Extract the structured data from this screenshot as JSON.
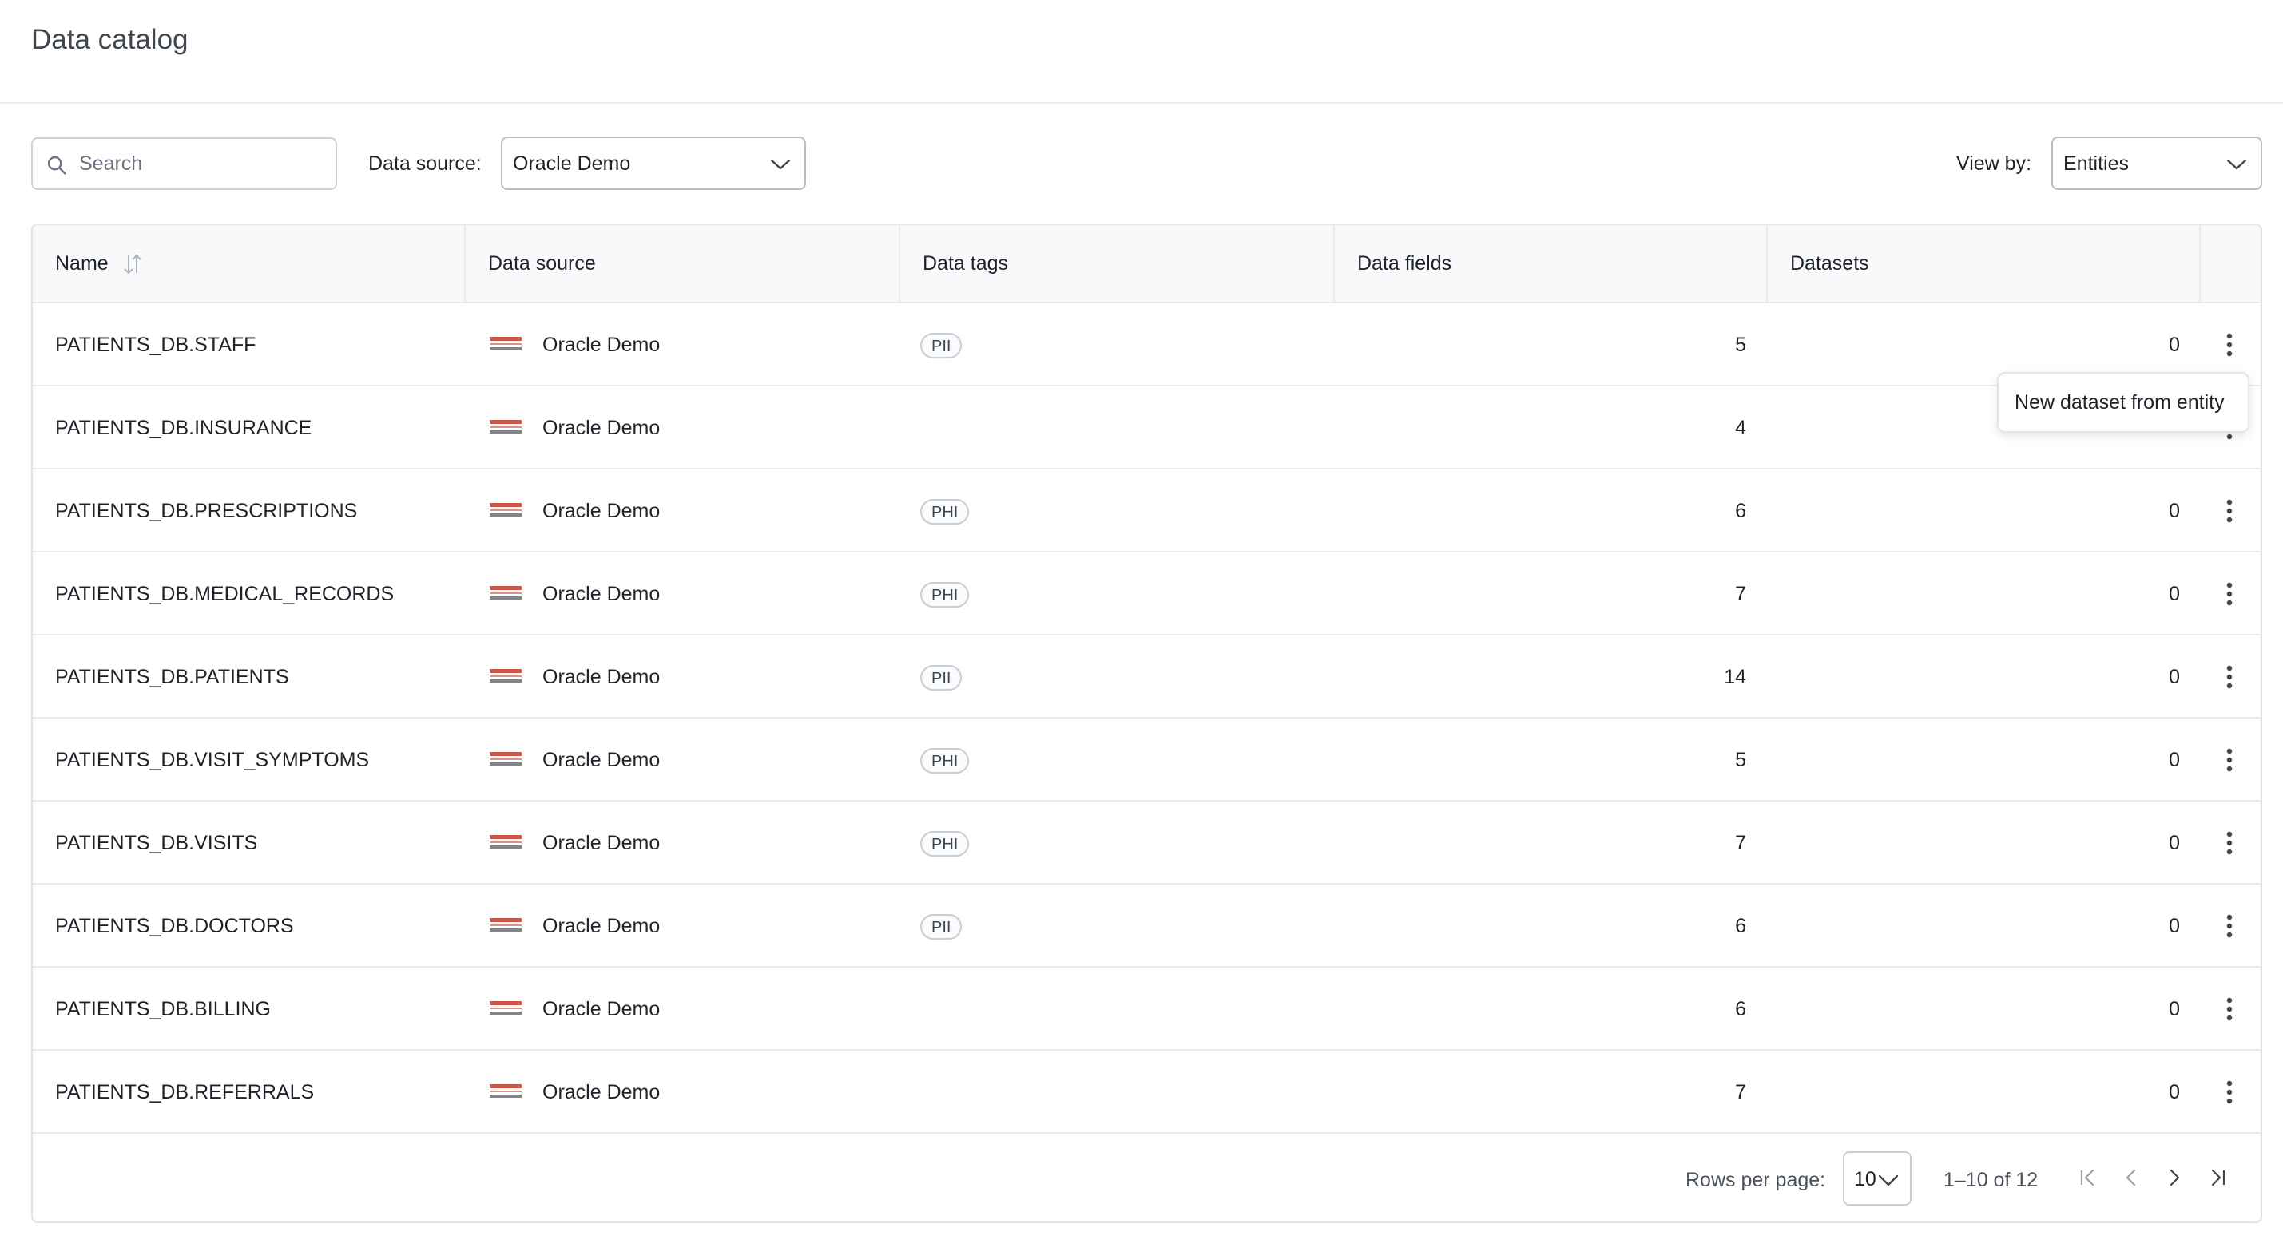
{
  "header": {
    "title": "Data catalog"
  },
  "toolbar": {
    "search_placeholder": "Search",
    "data_source_label": "Data source:",
    "data_source_value": "Oracle Demo",
    "view_by_label": "View by:",
    "view_by_value": "Entities"
  },
  "table": {
    "columns": [
      "Name",
      "Data source",
      "Data tags",
      "Data fields",
      "Datasets"
    ],
    "rows": [
      {
        "name": "PATIENTS_DB.STAFF",
        "source": "Oracle Demo",
        "tag": "PII",
        "fields": "5",
        "datasets": "0"
      },
      {
        "name": "PATIENTS_DB.INSURANCE",
        "source": "Oracle Demo",
        "tag": "",
        "fields": "4",
        "datasets": ""
      },
      {
        "name": "PATIENTS_DB.PRESCRIPTIONS",
        "source": "Oracle Demo",
        "tag": "PHI",
        "fields": "6",
        "datasets": "0"
      },
      {
        "name": "PATIENTS_DB.MEDICAL_RECORDS",
        "source": "Oracle Demo",
        "tag": "PHI",
        "fields": "7",
        "datasets": "0"
      },
      {
        "name": "PATIENTS_DB.PATIENTS",
        "source": "Oracle Demo",
        "tag": "PII",
        "fields": "14",
        "datasets": "0"
      },
      {
        "name": "PATIENTS_DB.VISIT_SYMPTOMS",
        "source": "Oracle Demo",
        "tag": "PHI",
        "fields": "5",
        "datasets": "0"
      },
      {
        "name": "PATIENTS_DB.VISITS",
        "source": "Oracle Demo",
        "tag": "PHI",
        "fields": "7",
        "datasets": "0"
      },
      {
        "name": "PATIENTS_DB.DOCTORS",
        "source": "Oracle Demo",
        "tag": "PII",
        "fields": "6",
        "datasets": "0"
      },
      {
        "name": "PATIENTS_DB.BILLING",
        "source": "Oracle Demo",
        "tag": "",
        "fields": "6",
        "datasets": "0"
      },
      {
        "name": "PATIENTS_DB.REFERRALS",
        "source": "Oracle Demo",
        "tag": "",
        "fields": "7",
        "datasets": "0"
      }
    ]
  },
  "row_menu": {
    "item": "New dataset from entity"
  },
  "pagination": {
    "rows_per_page_label": "Rows per page:",
    "rows_per_page_value": "10",
    "range_text": "1–10 of 12"
  },
  "icons": {
    "search": "search-icon",
    "chevron": "chevron-down-icon",
    "sort": "sort-icon",
    "logo": "oracle-database-logo",
    "kebab": "more-vertical-icon",
    "first": "first-page-icon",
    "prev": "prev-page-icon",
    "next": "next-page-icon",
    "last": "last-page-icon"
  },
  "colors": {
    "oracle_red": "#c74634",
    "border": "#cfd3d9",
    "header_bg": "#f8f9fa"
  }
}
